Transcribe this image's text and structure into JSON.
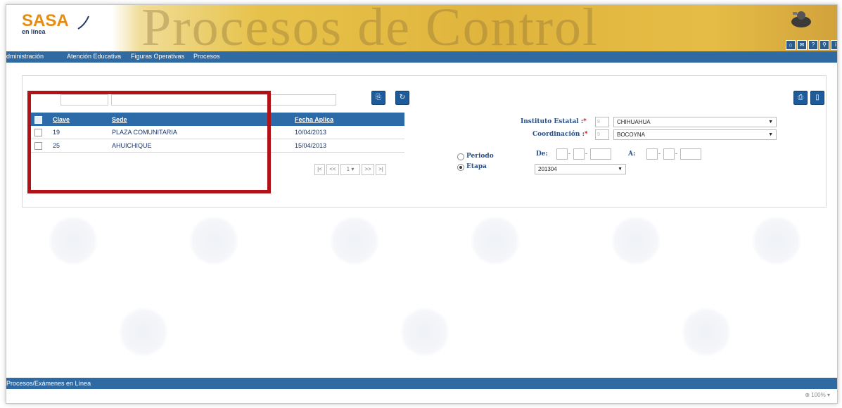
{
  "header": {
    "logo_text": "SASA",
    "logo_sub": "en línea",
    "banner_title": "Procesos de Control",
    "icons": [
      "home-icon",
      "mail-icon",
      "help-icon",
      "search-icon",
      "info-icon"
    ],
    "icon_glyphs": [
      "⌂",
      "✉",
      "?",
      "⚲",
      "i"
    ]
  },
  "menu": {
    "items": [
      "dministración",
      "Atención Educativa",
      "Figuras Operativas",
      "Procesos"
    ]
  },
  "toolbar_left": {
    "buttons": [
      "export-icon",
      "refresh-icon"
    ],
    "glyphs": [
      "⎘",
      "↻"
    ]
  },
  "toolbar_right": {
    "buttons": [
      "print-icon",
      "document-icon"
    ],
    "glyphs": [
      "⎙",
      "▯"
    ]
  },
  "grid": {
    "columns": [
      "Clave",
      "Sede",
      "Fecha Aplica"
    ],
    "rows": [
      {
        "clave": "19",
        "sede": "PLAZA COMUNITARIA",
        "fecha": "10/04/2013"
      },
      {
        "clave": "25",
        "sede": "AHUICHIQUE",
        "fecha": "15/04/2013"
      }
    ]
  },
  "pager": {
    "first": "|<",
    "prev": "<<",
    "page": "1",
    "next": ">>",
    "last": ">|"
  },
  "form": {
    "instituto_label": "Instituto Estatal :",
    "instituto_code": "8",
    "instituto_value": "CHIHUAHUA",
    "coordinacion_label": "Coordinación :",
    "coordinacion_code": "9",
    "coordinacion_value": "BOCOYNA",
    "required_mark": "*",
    "periodo_label": "Periodo",
    "etapa_label": "Etapa",
    "de_label": "De:",
    "a_label": "A:",
    "date_sep": "-",
    "etapa_value": "201304",
    "selected_option": "Etapa"
  },
  "footer": {
    "text": "Procesos/Exámenes en Línea",
    "zoom": "100%"
  },
  "colors": {
    "menu_blue": "#2f6aa2",
    "grid_header": "#2c6ba7",
    "highlight_red": "#b01218",
    "banner_gold": "#e0b43c"
  }
}
